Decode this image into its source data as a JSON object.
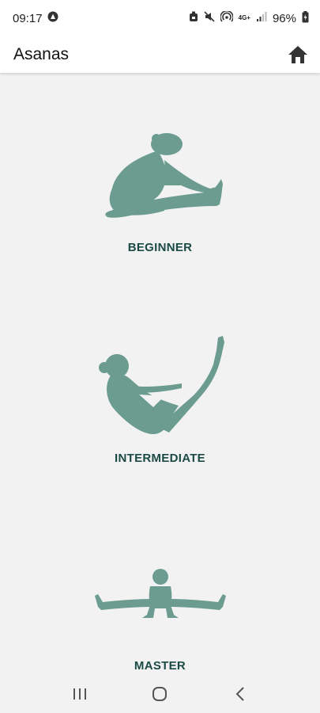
{
  "status_bar": {
    "time": "09:17",
    "network": "4G+",
    "battery": "96%"
  },
  "app_bar": {
    "title": "Asanas",
    "home_icon": "home-icon"
  },
  "levels": [
    {
      "label": "BEGINNER",
      "icon": "seated-forward-bend-pose"
    },
    {
      "label": "INTERMEDIATE",
      "icon": "boat-pose"
    },
    {
      "label": "MASTER",
      "icon": "side-split-pose"
    }
  ],
  "nav_bar": {
    "items": [
      "recent-apps-icon",
      "home-circle-icon",
      "back-icon"
    ]
  },
  "colors": {
    "figure": "#6b9c8f",
    "label": "#1b4a45",
    "background": "#f2f2f2"
  }
}
